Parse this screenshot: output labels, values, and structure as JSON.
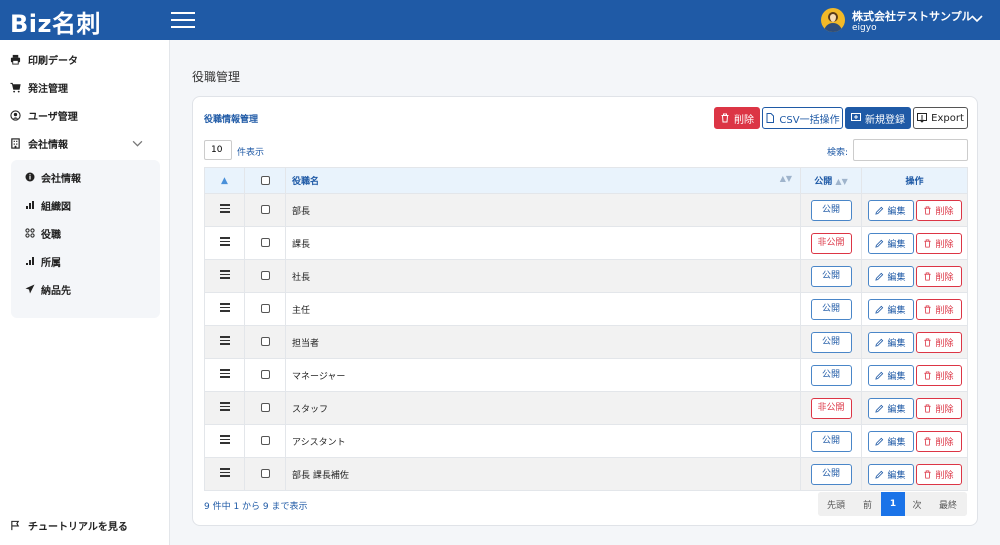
{
  "header": {
    "logo": "Biz名刺",
    "company": "株式会社テストサンプル",
    "username": "eigyo"
  },
  "sidebar": {
    "items": [
      {
        "label": "印刷データ",
        "icon": "printer-icon"
      },
      {
        "label": "発注管理",
        "icon": "cart-icon"
      },
      {
        "label": "ユーザ管理",
        "icon": "user-circle-icon"
      },
      {
        "label": "会社情報",
        "icon": "building-icon"
      }
    ],
    "submenu": [
      {
        "label": "会社情報",
        "icon": "info-icon"
      },
      {
        "label": "組織図",
        "icon": "bar-chart-icon"
      },
      {
        "label": "役職",
        "icon": "nodes-icon"
      },
      {
        "label": "所属",
        "icon": "signal-icon"
      },
      {
        "label": "納品先",
        "icon": "send-icon"
      }
    ],
    "tutorial": "チュートリアルを見る"
  },
  "main": {
    "page_title": "役職管理",
    "card_title": "役職情報管理",
    "buttons": {
      "delete": "削除",
      "csv": "CSV一括操作",
      "new": "新規登録",
      "export": "Export"
    },
    "page_length": "10",
    "page_length_label": "件表示",
    "search_label": "検索:",
    "search_value": ""
  },
  "table": {
    "headers": {
      "name": "役職名",
      "public": "公開",
      "ops": "操作"
    },
    "rows": [
      {
        "name": "部長",
        "status": "公開",
        "public": true
      },
      {
        "name": "課長",
        "status": "非公開",
        "public": false
      },
      {
        "name": "社長",
        "status": "公開",
        "public": true
      },
      {
        "name": "主任",
        "status": "公開",
        "public": true
      },
      {
        "name": "担当者",
        "status": "公開",
        "public": true
      },
      {
        "name": "マネージャー",
        "status": "公開",
        "public": true
      },
      {
        "name": "スタッフ",
        "status": "非公開",
        "public": false
      },
      {
        "name": "アシスタント",
        "status": "公開",
        "public": true
      },
      {
        "name": "部長 課長補佐",
        "status": "公開",
        "public": true
      }
    ],
    "edit_label": "編集",
    "delete_label": "削除"
  },
  "footer": {
    "info": "9 件中 1 から 9 まで表示",
    "pagination": {
      "first": "先頭",
      "prev": "前",
      "current": "1",
      "next": "次",
      "last": "最終"
    }
  },
  "colors": {
    "brand": "#1f5aa6",
    "danger": "#dc3545",
    "active_page": "#1a73e8"
  }
}
